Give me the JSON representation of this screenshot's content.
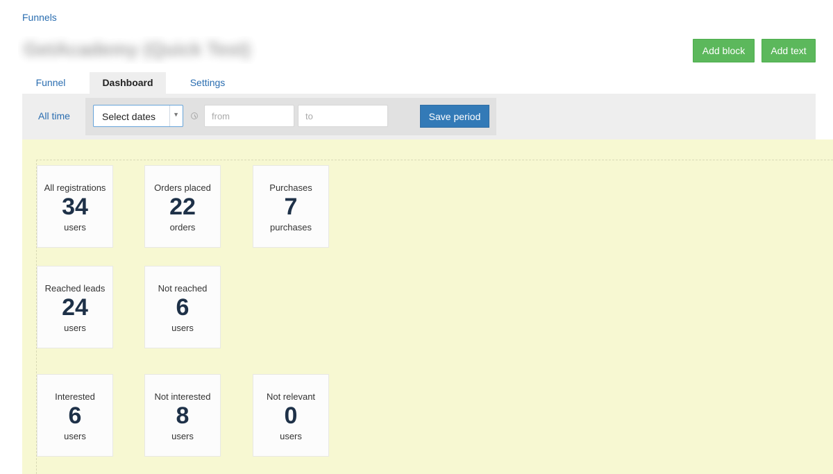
{
  "breadcrumb": {
    "label": "Funnels"
  },
  "header": {
    "title": "GetAcademy (Quick Test)",
    "add_block_label": "Add block",
    "add_text_label": "Add text"
  },
  "tabs": [
    {
      "label": "Funnel",
      "active": false
    },
    {
      "label": "Dashboard",
      "active": true
    },
    {
      "label": "Settings",
      "active": false
    }
  ],
  "filter": {
    "all_time_label": "All time",
    "select_value": "Select dates",
    "from_placeholder": "from",
    "to_placeholder": "to",
    "save_label": "Save period"
  },
  "cards": [
    {
      "title": "All registrations",
      "value": "34",
      "unit": "users"
    },
    {
      "title": "Orders placed",
      "value": "22",
      "unit": "orders"
    },
    {
      "title": "Purchases",
      "value": "7",
      "unit": "purchases"
    },
    {
      "title": "Reached leads",
      "value": "24",
      "unit": "users"
    },
    {
      "title": "Not reached",
      "value": "6",
      "unit": "users"
    },
    {
      "title": "Interested",
      "value": "6",
      "unit": "users"
    },
    {
      "title": "Not interested",
      "value": "8",
      "unit": "users"
    },
    {
      "title": "Not relevant",
      "value": "0",
      "unit": "users"
    }
  ],
  "colors": {
    "link": "#2a6db0",
    "success_button": "#5cb85c",
    "primary_button": "#337ab7",
    "dashboard_background": "#f7f8d2",
    "metric_value": "#1e3148"
  }
}
